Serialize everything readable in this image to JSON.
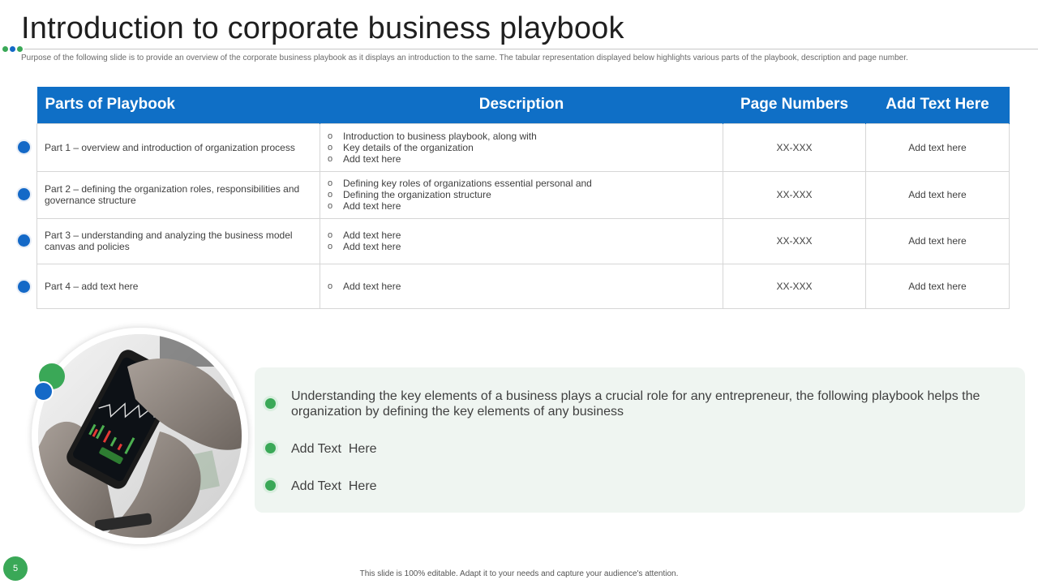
{
  "slide": {
    "title": "Introduction to corporate business playbook",
    "subtitle": "Purpose of the following slide is to provide an overview of the corporate business playbook as it displays an introduction to the same. The tabular representation displayed below highlights various parts of the playbook, description and page number.",
    "page_number": "5",
    "footer": "This slide is 100% editable. Adapt it to your needs and capture your audience's attention."
  },
  "colors": {
    "header_blue": "#0f6fc6",
    "accent_green": "#3aa857",
    "panel_bg": "#eff5f1"
  },
  "table": {
    "headers": [
      "Parts of Playbook",
      "Description",
      "Page Numbers",
      "Add Text Here"
    ],
    "rows": [
      {
        "part": "Part 1 – overview and introduction of organization process",
        "description": [
          "Introduction to business playbook, along with",
          "Key details of the organization",
          "Add text here"
        ],
        "pages": "XX-XXX",
        "extra": "Add text here"
      },
      {
        "part": "Part 2 – defining the organization roles, responsibilities and governance structure",
        "description": [
          "Defining key roles of organizations essential personal and",
          "Defining the organization structure",
          "Add text here"
        ],
        "pages": "XX-XXX",
        "extra": "Add text here"
      },
      {
        "part": "Part 3 – understanding and analyzing the business model canvas and policies",
        "description": [
          "Add text here",
          "Add text here"
        ],
        "pages": "XX-XXX",
        "extra": "Add text here"
      },
      {
        "part": "Part 4 – add text here",
        "description": [
          "Add text here"
        ],
        "pages": "XX-XXX",
        "extra": "Add text here"
      }
    ]
  },
  "info_panel": {
    "items": [
      "Understanding the key elements of a business plays a crucial role for any entrepreneur,  the following playbook helps the organization by defining the key elements of any business",
      "Add Text  Here",
      "Add Text  Here"
    ]
  }
}
